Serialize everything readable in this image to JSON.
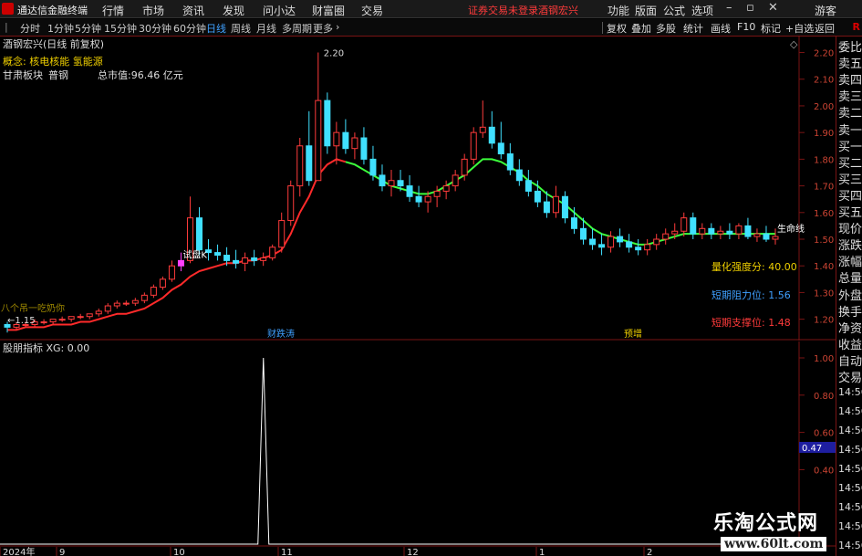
{
  "menubar": {
    "app_name": "通达信金融终端",
    "menus": [
      "行情",
      "市场",
      "资讯",
      "发现",
      "问小达",
      "财富圈",
      "交易"
    ],
    "notice": "证券交易未登录",
    "stock_name": "酒钢宏兴",
    "right_menus": [
      "功能",
      "版面",
      "公式",
      "选项"
    ],
    "user": "游客"
  },
  "periodbar": {
    "periods": [
      "分时",
      "1分钟",
      "5分钟",
      "15分钟",
      "30分钟",
      "60分钟",
      "日线",
      "周线",
      "月线",
      "多周期",
      "更多"
    ],
    "active_period": "日线",
    "tools": [
      "复权",
      "叠加",
      "多股",
      "统计",
      "画线",
      "F10",
      "标记",
      "+自选",
      "返回"
    ],
    "corner": "R"
  },
  "chart_header": {
    "title": "酒钢宏兴(日线 前复权)",
    "concept": "概念: 核电核能 氢能源",
    "sector_label": "甘肃板块",
    "sector_tag": "普钢",
    "market_cap": "总市值:96.46 亿元"
  },
  "annotations": {
    "high_label": "2.20",
    "low_label": "1.15",
    "trial_label": "试盘K",
    "life_line_label": "生命线",
    "cover_text": "八个吊一吃奶你",
    "event_1": "财跌涛",
    "event_2": "预增"
  },
  "stats": {
    "quant_strength": "量化强度分: 40.00",
    "resistance": "短期阻力位: 1.56",
    "support": "短期支撑位: 1.48"
  },
  "subchart": {
    "title": "股朋指标 XG: 0.00",
    "current_value": "0.47"
  },
  "right_panel": {
    "labels": [
      "委比",
      "卖五",
      "卖四",
      "卖三",
      "卖二",
      "卖一",
      "买一",
      "买二",
      "买三",
      "买四",
      "买五",
      "现价",
      "涨跌",
      "涨幅",
      "总量",
      "外盘",
      "换手",
      "净资",
      "收益",
      "自动",
      "交易"
    ],
    "times": [
      "14:56",
      "14:56",
      "14:56",
      "14:56",
      "14:56",
      "14:56",
      "14:56",
      "14:56",
      "14:56"
    ]
  },
  "watermark": {
    "title": "乐淘公式网",
    "url": "www.60lt.com"
  },
  "chart_data": [
    {
      "type": "candlestick",
      "title": "",
      "y_axis_ticks": [
        1.2,
        1.3,
        1.4,
        1.5,
        1.6,
        1.7,
        1.8,
        1.9,
        2.0,
        2.1,
        2.2
      ],
      "ylim": [
        1.12,
        2.26
      ],
      "x_labels": [
        "2024年",
        "9",
        "10",
        "11",
        "12",
        "1",
        "2"
      ],
      "candles": [
        [
          1.18,
          1.19,
          1.15,
          1.17
        ],
        [
          1.17,
          1.19,
          1.16,
          1.18
        ],
        [
          1.18,
          1.19,
          1.17,
          1.18
        ],
        [
          1.18,
          1.2,
          1.17,
          1.19
        ],
        [
          1.19,
          1.2,
          1.18,
          1.19
        ],
        [
          1.19,
          1.2,
          1.18,
          1.2
        ],
        [
          1.2,
          1.21,
          1.19,
          1.2
        ],
        [
          1.2,
          1.21,
          1.19,
          1.21
        ],
        [
          1.21,
          1.22,
          1.2,
          1.21
        ],
        [
          1.21,
          1.22,
          1.2,
          1.22
        ],
        [
          1.22,
          1.24,
          1.21,
          1.23
        ],
        [
          1.23,
          1.26,
          1.22,
          1.25
        ],
        [
          1.25,
          1.27,
          1.24,
          1.26
        ],
        [
          1.26,
          1.27,
          1.25,
          1.26
        ],
        [
          1.26,
          1.28,
          1.25,
          1.27
        ],
        [
          1.27,
          1.3,
          1.26,
          1.29
        ],
        [
          1.29,
          1.33,
          1.28,
          1.32
        ],
        [
          1.32,
          1.36,
          1.31,
          1.35
        ],
        [
          1.35,
          1.42,
          1.34,
          1.4
        ],
        [
          1.4,
          1.45,
          1.38,
          1.42
        ],
        [
          1.42,
          1.66,
          1.41,
          1.58
        ],
        [
          1.58,
          1.62,
          1.44,
          1.46
        ],
        [
          1.46,
          1.5,
          1.42,
          1.45
        ],
        [
          1.45,
          1.48,
          1.42,
          1.44
        ],
        [
          1.44,
          1.47,
          1.4,
          1.42
        ],
        [
          1.42,
          1.46,
          1.39,
          1.41
        ],
        [
          1.41,
          1.45,
          1.38,
          1.43
        ],
        [
          1.43,
          1.46,
          1.4,
          1.42
        ],
        [
          1.42,
          1.45,
          1.4,
          1.43
        ],
        [
          1.43,
          1.48,
          1.42,
          1.47
        ],
        [
          1.47,
          1.6,
          1.45,
          1.57
        ],
        [
          1.57,
          1.72,
          1.55,
          1.7
        ],
        [
          1.7,
          1.88,
          1.66,
          1.85
        ],
        [
          1.85,
          1.98,
          1.7,
          1.72
        ],
        [
          1.72,
          2.2,
          1.72,
          2.02
        ],
        [
          2.02,
          2.05,
          1.82,
          1.85
        ],
        [
          1.85,
          1.94,
          1.78,
          1.9
        ],
        [
          1.9,
          1.95,
          1.82,
          1.84
        ],
        [
          1.84,
          1.9,
          1.8,
          1.88
        ],
        [
          1.88,
          1.92,
          1.78,
          1.8
        ],
        [
          1.8,
          1.85,
          1.72,
          1.74
        ],
        [
          1.74,
          1.78,
          1.68,
          1.7
        ],
        [
          1.7,
          1.76,
          1.66,
          1.72
        ],
        [
          1.72,
          1.76,
          1.68,
          1.7
        ],
        [
          1.7,
          1.74,
          1.64,
          1.66
        ],
        [
          1.66,
          1.7,
          1.62,
          1.64
        ],
        [
          1.64,
          1.68,
          1.6,
          1.66
        ],
        [
          1.66,
          1.7,
          1.62,
          1.68
        ],
        [
          1.68,
          1.72,
          1.65,
          1.7
        ],
        [
          1.7,
          1.76,
          1.68,
          1.74
        ],
        [
          1.74,
          1.82,
          1.72,
          1.8
        ],
        [
          1.8,
          1.92,
          1.78,
          1.9
        ],
        [
          1.9,
          2.02,
          1.88,
          1.92
        ],
        [
          1.92,
          1.98,
          1.84,
          1.86
        ],
        [
          1.86,
          1.94,
          1.8,
          1.82
        ],
        [
          1.82,
          1.86,
          1.74,
          1.76
        ],
        [
          1.76,
          1.8,
          1.7,
          1.72
        ],
        [
          1.72,
          1.76,
          1.66,
          1.68
        ],
        [
          1.68,
          1.72,
          1.62,
          1.64
        ],
        [
          1.64,
          1.68,
          1.58,
          1.6
        ],
        [
          1.6,
          1.7,
          1.58,
          1.66
        ],
        [
          1.66,
          1.68,
          1.56,
          1.58
        ],
        [
          1.58,
          1.62,
          1.52,
          1.54
        ],
        [
          1.54,
          1.58,
          1.48,
          1.5
        ],
        [
          1.5,
          1.54,
          1.46,
          1.48
        ],
        [
          1.48,
          1.52,
          1.44,
          1.47
        ],
        [
          1.47,
          1.53,
          1.45,
          1.51
        ],
        [
          1.51,
          1.54,
          1.47,
          1.49
        ],
        [
          1.49,
          1.52,
          1.45,
          1.47
        ],
        [
          1.47,
          1.5,
          1.44,
          1.46
        ],
        [
          1.46,
          1.5,
          1.44,
          1.48
        ],
        [
          1.48,
          1.52,
          1.46,
          1.5
        ],
        [
          1.5,
          1.54,
          1.48,
          1.52
        ],
        [
          1.52,
          1.56,
          1.5,
          1.53
        ],
        [
          1.53,
          1.6,
          1.51,
          1.58
        ],
        [
          1.58,
          1.6,
          1.5,
          1.52
        ],
        [
          1.52,
          1.56,
          1.5,
          1.54
        ],
        [
          1.54,
          1.56,
          1.5,
          1.52
        ],
        [
          1.52,
          1.55,
          1.5,
          1.53
        ],
        [
          1.53,
          1.56,
          1.5,
          1.52
        ],
        [
          1.52,
          1.56,
          1.5,
          1.55
        ],
        [
          1.55,
          1.58,
          1.5,
          1.51
        ],
        [
          1.51,
          1.54,
          1.49,
          1.52
        ],
        [
          1.52,
          1.55,
          1.49,
          1.5
        ],
        [
          1.5,
          1.54,
          1.48,
          1.51
        ]
      ],
      "ma_red": [
        1.16,
        1.16,
        1.17,
        1.17,
        1.17,
        1.18,
        1.18,
        1.18,
        1.19,
        1.19,
        1.2,
        1.21,
        1.22,
        1.22,
        1.23,
        1.24,
        1.26,
        1.28,
        1.31,
        1.33,
        1.36,
        1.38,
        1.39,
        1.4,
        1.41,
        1.41,
        1.42,
        1.42,
        1.43,
        1.44,
        1.46,
        1.52,
        1.6,
        1.66,
        1.74,
        1.78,
        1.8,
        1.79,
        1.78,
        1.76,
        1.74,
        1.72,
        1.7,
        1.69,
        1.68,
        1.67,
        1.67,
        1.68,
        1.7,
        1.72,
        1.74,
        1.77,
        1.8,
        1.8,
        1.79,
        1.77,
        1.75,
        1.72,
        1.7,
        1.67,
        1.65,
        1.63,
        1.6,
        1.57,
        1.54,
        1.52,
        1.51,
        1.5,
        1.49,
        1.48,
        1.48,
        1.49,
        1.5,
        1.51,
        1.52,
        1.52,
        1.52,
        1.52,
        1.52,
        1.52,
        1.52,
        1.52,
        1.52,
        1.52,
        1.52
      ],
      "ma_green_from": 37,
      "subchart_spike_index": 32
    }
  ]
}
